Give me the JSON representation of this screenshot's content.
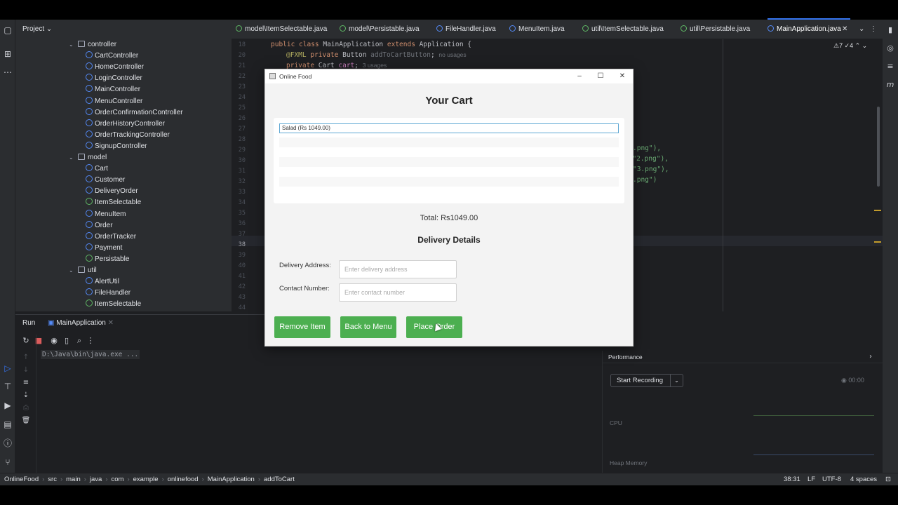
{
  "ide": {
    "project_label": "Project",
    "tree": [
      {
        "label": "controller",
        "kind": "folder",
        "indent": 1,
        "expanded": true
      },
      {
        "label": "CartController",
        "kind": "class",
        "indent": 2
      },
      {
        "label": "HomeController",
        "kind": "class",
        "indent": 2
      },
      {
        "label": "LoginController",
        "kind": "class",
        "indent": 2
      },
      {
        "label": "MainController",
        "kind": "class",
        "indent": 2
      },
      {
        "label": "MenuController",
        "kind": "class",
        "indent": 2
      },
      {
        "label": "OrderConfirmationController",
        "kind": "class",
        "indent": 2
      },
      {
        "label": "OrderHistoryController",
        "kind": "class",
        "indent": 2
      },
      {
        "label": "OrderTrackingController",
        "kind": "class",
        "indent": 2
      },
      {
        "label": "SignupController",
        "kind": "class",
        "indent": 2
      },
      {
        "label": "model",
        "kind": "folder",
        "indent": 1,
        "expanded": true
      },
      {
        "label": "Cart",
        "kind": "class",
        "indent": 2
      },
      {
        "label": "Customer",
        "kind": "class",
        "indent": 2
      },
      {
        "label": "DeliveryOrder",
        "kind": "class",
        "indent": 2
      },
      {
        "label": "ItemSelectable",
        "kind": "interface",
        "indent": 2
      },
      {
        "label": "MenuItem",
        "kind": "class",
        "indent": 2
      },
      {
        "label": "Order",
        "kind": "class",
        "indent": 2
      },
      {
        "label": "OrderTracker",
        "kind": "class",
        "indent": 2
      },
      {
        "label": "Payment",
        "kind": "class",
        "indent": 2
      },
      {
        "label": "Persistable",
        "kind": "interface",
        "indent": 2
      },
      {
        "label": "util",
        "kind": "folder",
        "indent": 1,
        "expanded": true
      },
      {
        "label": "AlertUtil",
        "kind": "class",
        "indent": 2
      },
      {
        "label": "FileHandler",
        "kind": "class",
        "indent": 2
      },
      {
        "label": "ItemSelectable",
        "kind": "interface",
        "indent": 2
      }
    ],
    "tabs": [
      {
        "label": "model\\ItemSelectable.java",
        "icon": "interface"
      },
      {
        "label": "model\\Persistable.java",
        "icon": "interface"
      },
      {
        "label": "FileHandler.java",
        "icon": "class"
      },
      {
        "label": "MenuItem.java",
        "icon": "class"
      },
      {
        "label": "util\\ItemSelectable.java",
        "icon": "interface"
      },
      {
        "label": "util\\Persistable.java",
        "icon": "interface"
      },
      {
        "label": "MainApplication.java",
        "icon": "class",
        "active": true
      }
    ],
    "editor": {
      "warnings": "⚠7 ✓4",
      "line_numbers": [
        "18",
        "20",
        "21",
        "22",
        "23",
        "24",
        "25",
        "26",
        "27",
        "28",
        "29",
        "30",
        "31",
        "32",
        "33",
        "34",
        "35",
        "36",
        "37",
        "38",
        "39",
        "40",
        "41",
        "42",
        "43",
        "44"
      ],
      "line1": {
        "kw": "public class ",
        "name": "MainApplication ",
        "kw2": "extends ",
        "rest": "Application {"
      },
      "line2": {
        "ann": "@FXML ",
        "kw": "private ",
        "rest": "Button ",
        "var": "addToCartButton",
        "semi": ";",
        "hint": "no usages"
      },
      "line3": {
        "kw": "private ",
        "rest": "Cart ",
        "var": "cart",
        "semi": ";",
        "hint": "3 usages"
      },
      "fragments": [
        ".png\"),",
        "e \"2.png\"),",
        "\"3.png\"),",
        ".png\")"
      ]
    },
    "run": {
      "label": "Run",
      "tab": "MainApplication",
      "console": "D:\\Java\\bin\\java.exe ..."
    },
    "performance": {
      "title": "Performance",
      "record_label": "Start Recording",
      "timer": "00:00",
      "cpu_label": "CPU",
      "heap_label": "Heap Memory"
    },
    "status": {
      "breadcrumbs": [
        "OnlineFood",
        "src",
        "main",
        "java",
        "com",
        "example",
        "onlinefood",
        "MainApplication",
        "addToCart"
      ],
      "position": "38:31",
      "line_sep": "LF",
      "encoding": "UTF-8",
      "indent": "4 spaces"
    }
  },
  "dialog": {
    "window_title": "Online Food",
    "heading": "Your Cart",
    "cart_items": [
      "Salad (Rs 1049.00)"
    ],
    "total": "Total: Rs1049.00",
    "delivery_heading": "Delivery Details",
    "address_label": "Delivery Address:",
    "address_placeholder": "Enter delivery address",
    "contact_label": "Contact Number:",
    "contact_placeholder": "Enter contact number",
    "buttons": {
      "remove": "Remove Item",
      "back": "Back to Menu",
      "place": "Place Order"
    },
    "button_color": "#4caf50"
  }
}
